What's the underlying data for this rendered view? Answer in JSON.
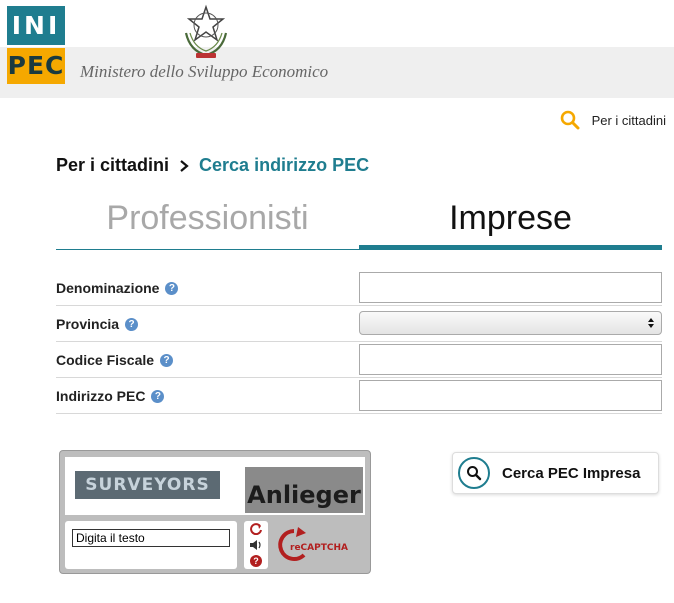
{
  "header": {
    "logo_top": "INI",
    "logo_bottom": "PEC",
    "ministry": "Ministero dello Sviluppo Economico",
    "top_link": "Per i cittadini"
  },
  "breadcrumb": {
    "root": "Per i cittadini",
    "current": "Cerca indirizzo PEC"
  },
  "tabs": [
    {
      "label": "Professionisti",
      "active": false
    },
    {
      "label": "Imprese",
      "active": true
    }
  ],
  "form": {
    "fields": [
      {
        "label": "Denominazione",
        "value": ""
      },
      {
        "label": "Provincia",
        "value": ""
      },
      {
        "label": "Codice Fiscale",
        "value": ""
      },
      {
        "label": "Indirizzo PEC",
        "value": ""
      }
    ],
    "help_glyph": "?"
  },
  "captcha": {
    "word1": "SURVEYORS",
    "word2": "Anlieger",
    "input_value": "Digita il testo",
    "brand_text": "reCAPTCHA"
  },
  "search_button": {
    "label": "Cerca PEC Impresa"
  },
  "colors": {
    "accent": "#1f7d8f",
    "logo_yellow": "#f5a800",
    "search_orange": "#f5a800",
    "help_blue": "#5b8fc9",
    "captcha_red": "#b21f1f"
  }
}
